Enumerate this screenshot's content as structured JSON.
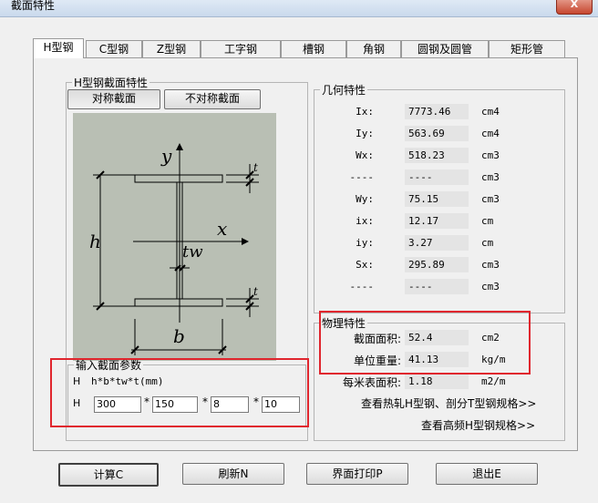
{
  "window": {
    "title": "截面特性",
    "close_label": "X"
  },
  "tabs": [
    {
      "label": "H型钢",
      "active": true
    },
    {
      "label": "C型钢"
    },
    {
      "label": "Z型钢"
    },
    {
      "label": "工字钢"
    },
    {
      "label": "槽钢"
    },
    {
      "label": "角钢"
    },
    {
      "label": "圆钢及圆管"
    },
    {
      "label": "矩形管"
    }
  ],
  "section_props": {
    "legend": "H型钢截面特性",
    "symmetric_button": "对称截面",
    "asymmetric_button": "不对称截面"
  },
  "diagram": {
    "y": "y",
    "x": "x",
    "h": "h",
    "b": "b",
    "tw": "tw",
    "t": "t"
  },
  "input": {
    "legend": "输入截面参数",
    "h_label": "H",
    "formula": "h*b*tw*t(mm)",
    "row_label": "H",
    "separator": "*",
    "values": [
      "300",
      "150",
      "8",
      "10"
    ]
  },
  "geometry": {
    "legend": "几何特性",
    "rows": [
      {
        "label": "Ix:",
        "value": "7773.46",
        "unit": "cm4"
      },
      {
        "label": "Iy:",
        "value": "563.69",
        "unit": "cm4"
      },
      {
        "label": "Wx:",
        "value": "518.23",
        "unit": "cm3"
      },
      {
        "label": "----",
        "value": "----",
        "unit": "cm3"
      },
      {
        "label": "Wy:",
        "value": "75.15",
        "unit": "cm3"
      },
      {
        "label": "ix:",
        "value": "12.17",
        "unit": "cm"
      },
      {
        "label": "iy:",
        "value": "3.27",
        "unit": "cm"
      },
      {
        "label": "Sx:",
        "value": "295.89",
        "unit": "cm3"
      },
      {
        "label": "----",
        "value": "----",
        "unit": "cm3"
      }
    ]
  },
  "physical": {
    "legend": "物理特性",
    "rows": [
      {
        "label": "截面面积:",
        "value": "52.4",
        "unit": "cm2"
      },
      {
        "label": "单位重量:",
        "value": "41.13",
        "unit": "kg/m"
      },
      {
        "label": "每米表面积:",
        "value": "1.18",
        "unit": "m2/m"
      }
    ],
    "link1": "查看热轧H型钢、剖分T型钢规格>>",
    "link2": "查看高频H型钢规格>>"
  },
  "buttons": {
    "calc": "计算C",
    "refresh": "刷新N",
    "print": "界面打印P",
    "exit": "退出E"
  },
  "colors": {
    "highlight": "#e0262e",
    "diagram_bg": "#b9bfb4"
  }
}
